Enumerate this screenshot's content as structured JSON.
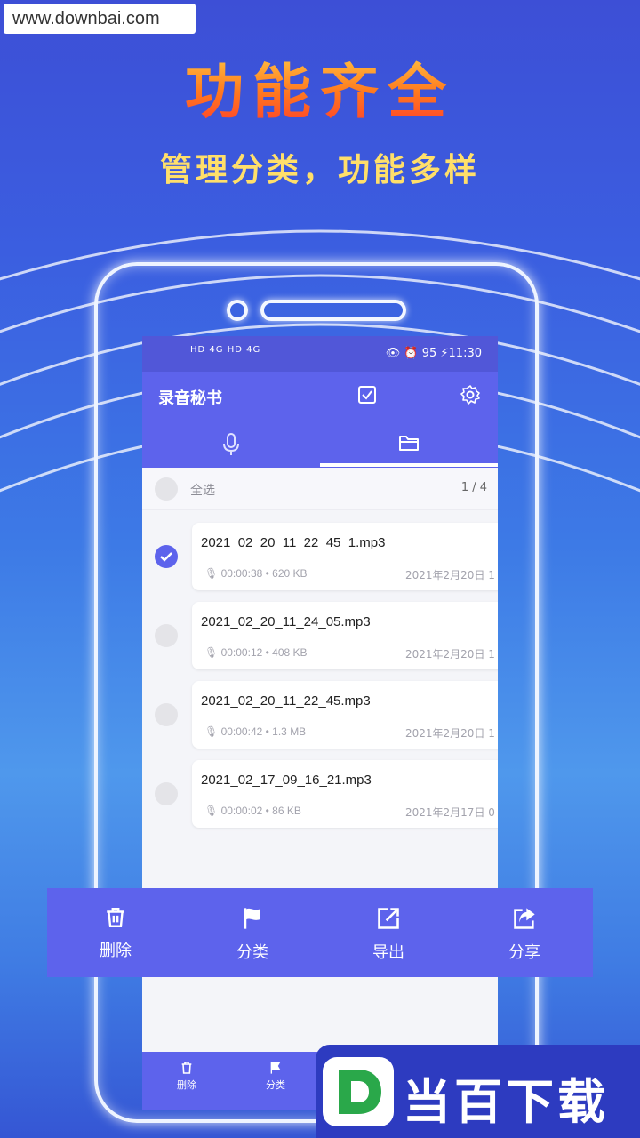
{
  "watermark": "www.downbai.com",
  "promo": {
    "headline": "功能齐全",
    "subline": "管理分类，功能多样"
  },
  "status_bar": {
    "left": "HD 4G HD 4G",
    "right": "👁 ⏰ 95 ⚡11:30"
  },
  "app": {
    "title": "录音秘书",
    "icons": [
      "checkbox-icon",
      "settings-icon"
    ],
    "tabs": [
      {
        "icon": "microphone-icon",
        "active": false
      },
      {
        "icon": "folder-icon",
        "active": true
      }
    ]
  },
  "select_all": {
    "label": "全选",
    "count": "1 / 4"
  },
  "recordings": [
    {
      "name": "2021_02_20_11_22_45_1.mp3",
      "duration": "00:00:38",
      "size": "620 KB",
      "date": "2021年2月20日 1",
      "checked": true
    },
    {
      "name": "2021_02_20_11_24_05.mp3",
      "duration": "00:00:12",
      "size": "408 KB",
      "date": "2021年2月20日 1",
      "checked": false
    },
    {
      "name": "2021_02_20_11_22_45.mp3",
      "duration": "00:00:42",
      "size": "1.3 MB",
      "date": "2021年2月20日 1",
      "checked": false
    },
    {
      "name": "2021_02_17_09_16_21.mp3",
      "duration": "00:00:02",
      "size": "86 KB",
      "date": "2021年2月17日 0",
      "checked": false
    }
  ],
  "toolbar": {
    "delete": "删除",
    "category": "分类",
    "export": "导出",
    "share": "分享"
  },
  "logo": {
    "letter": "D",
    "text": "当百下载"
  },
  "colors": {
    "accent": "#5d63ec",
    "status_bar": "#5157d8",
    "headline": "#ff6a1f",
    "subline": "#ffdf6a"
  }
}
